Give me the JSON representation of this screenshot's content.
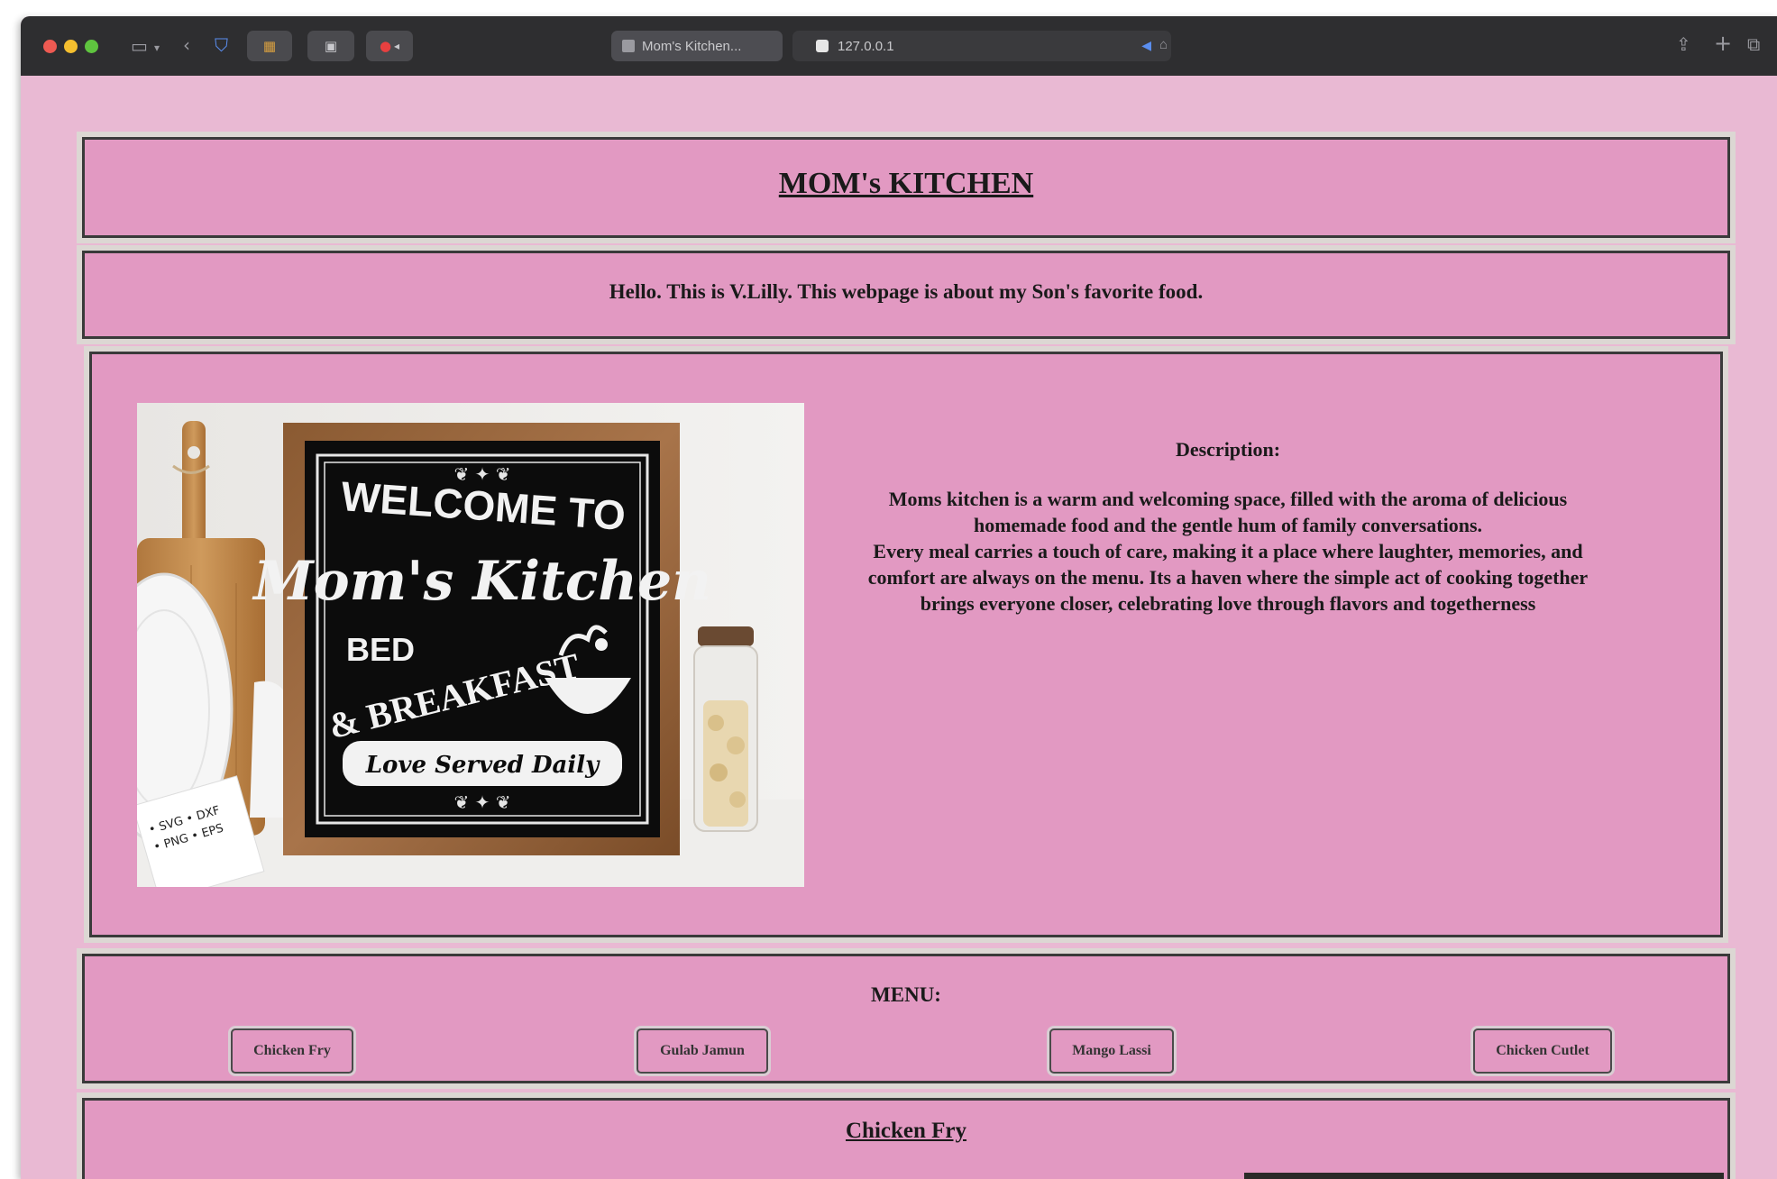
{
  "browser": {
    "tab_active_label": "Mom's Kitchen...",
    "address": "127.0.0.1"
  },
  "page": {
    "title": "MOM's KITCHEN",
    "intro": "Hello. This is V.Lilly. This webpage is about my Son's favorite food.",
    "description_heading": "Description:",
    "description_lines": [
      "Moms kitchen is a warm and welcoming space, filled with the aroma of delicious",
      "homemade food and the gentle hum of family conversations.",
      "Every meal carries a touch of care, making it a place where laughter, memories, and",
      "comfort are always on the menu. Its a haven where the simple act of cooking together",
      "brings everyone closer, celebrating love through flavors and togetherness"
    ],
    "hero_sign": {
      "line1": "WELCOME TO",
      "line2": "Mom's Kitchen",
      "line3": "BED",
      "line4": "& BREAKFAST",
      "line5": "Love Served Daily",
      "card_line1": "• SVG  • DXF",
      "card_line2": "• PNG  • EPS"
    },
    "menu_heading": "MENU:",
    "menu_items": [
      "Chicken Fry",
      "Gulab Jamun",
      "Mango Lassi",
      "Chicken Cutlet"
    ],
    "section_title": "Chicken Fry"
  }
}
